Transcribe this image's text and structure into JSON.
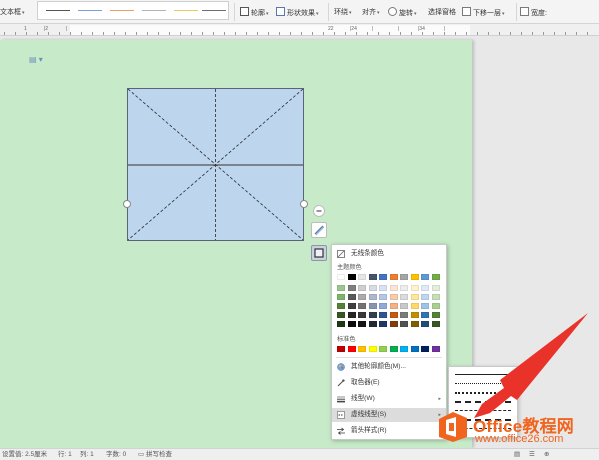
{
  "ribbon": {
    "text_box_label": "文本框",
    "outline_label": "轮廓",
    "shape_effect_label": "形状效果",
    "wrap_label": "环绕",
    "align_label": "对齐",
    "rotate_label": "旋转",
    "selection_pane_label": "选择窗格",
    "send_backward_label": "下移一层",
    "width_label": "宽度:"
  },
  "ruler": {
    "numbers": [
      "1",
      "|2",
      "|",
      "22",
      "|24",
      "|",
      "|",
      "|34",
      "|"
    ]
  },
  "outline_menu": {
    "no_line_color": "无线条颜色",
    "theme_colors_label": "主题颜色",
    "theme_colors_top": [
      "#ffffff",
      "#000000",
      "#e7e6e6",
      "#44546a",
      "#4472c4",
      "#ed7d31",
      "#a5a5a5",
      "#ffc000",
      "#5b9bd5",
      "#70ad47"
    ],
    "theme_colors_rows": [
      [
        "#9dc591",
        "#7f7f7f",
        "#d0cece",
        "#d6dce4",
        "#d9e2f3",
        "#fbe5d6",
        "#ededed",
        "#fff2cc",
        "#deebf6",
        "#e2efda"
      ],
      [
        "#7db46c",
        "#595959",
        "#aeaaaa",
        "#adb9ca",
        "#b4c7e7",
        "#f8cbad",
        "#dbdbdb",
        "#ffe699",
        "#bdd7ee",
        "#c5e0b4"
      ],
      [
        "#548235",
        "#3f3f3f",
        "#757171",
        "#8496b0",
        "#8eaadb",
        "#f4b183",
        "#c9c9c9",
        "#ffd966",
        "#9dc3e6",
        "#a9d18e"
      ],
      [
        "#375623",
        "#262626",
        "#3a3838",
        "#323f4f",
        "#2f5597",
        "#c55a11",
        "#7b7b7b",
        "#bf9000",
        "#2e75b6",
        "#538135"
      ],
      [
        "#1e3a12",
        "#0c0c0c",
        "#171616",
        "#222a35",
        "#203864",
        "#843c0c",
        "#525252",
        "#7f6000",
        "#1f4e79",
        "#375623"
      ]
    ],
    "standard_colors_label": "标准色",
    "standard_colors": [
      "#c00000",
      "#ff0000",
      "#ffc000",
      "#ffff00",
      "#92d050",
      "#00b050",
      "#00b0f0",
      "#0070c0",
      "#002060",
      "#7030a0"
    ],
    "more_colors": "其他轮廓颜色(M)...",
    "eyedropper": "取色器(E)",
    "line_type": "线型(W)",
    "dash_type": "虚线线型(S)",
    "arrow_style": "箭头样式(R)"
  },
  "status": {
    "position": "设置值: 2.5厘米",
    "row": "行: 1",
    "col": "列: 1",
    "word_count": "字数: 0",
    "spell_check": "拼写检查"
  },
  "watermark": {
    "title": "Office教程网",
    "url": "www.office26.com"
  },
  "colors": {
    "page_bg": "#c7ebc9",
    "shape_fill": "#bdd6ee",
    "accent_arrow": "#e8322a",
    "watermark_orange": "#f0641e"
  }
}
